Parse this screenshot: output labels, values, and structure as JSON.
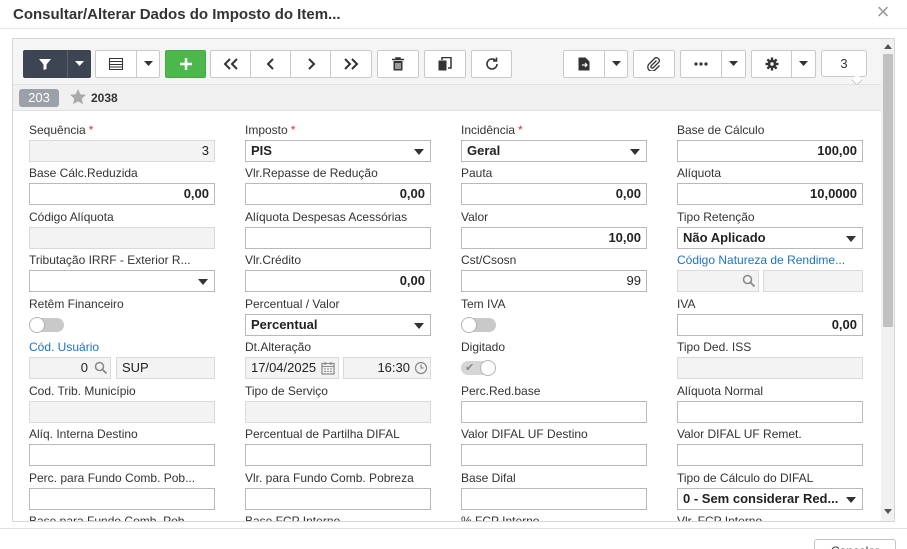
{
  "dialog": {
    "title": "Consultar/Alterar Dados do Imposto do Item...",
    "close_label": "×",
    "footer_button": "Cancelar"
  },
  "toolbar": {
    "icons": [
      "filter-icon",
      "chevron-down-icon",
      "grid-icon",
      "add-icon",
      "first-icon",
      "prev-icon",
      "next-icon",
      "last-icon",
      "trash-icon",
      "copy-icon",
      "refresh-icon",
      "export-icon",
      "attach-icon",
      "more-icon",
      "gear-icon"
    ],
    "counter": "3"
  },
  "record": {
    "id": "203",
    "code": "2038"
  },
  "fields": {
    "sequencia": {
      "label": "Sequência",
      "value": "3"
    },
    "imposto": {
      "label": "Imposto",
      "value": "PIS"
    },
    "incidencia": {
      "label": "Incidência",
      "value": "Geral"
    },
    "base_calculo": {
      "label": "Base de Cálculo",
      "value": "100,00"
    },
    "base_reduzida": {
      "label": "Base Cálc.Reduzida",
      "value": "0,00"
    },
    "vlr_repasse": {
      "label": "Vlr.Repasse de Redução",
      "value": "0,00"
    },
    "pauta": {
      "label": "Pauta",
      "value": "0,00"
    },
    "aliquota": {
      "label": "Alíquota",
      "value": "10,0000"
    },
    "codigo_aliquota": {
      "label": "Código Alíquota",
      "value": ""
    },
    "aliq_desp_acess": {
      "label": "Alíquota Despesas Acessórias",
      "value": ""
    },
    "valor": {
      "label": "Valor",
      "value": "10,00"
    },
    "tipo_retencao": {
      "label": "Tipo Retenção",
      "value": "Não Aplicado"
    },
    "tributacao_irrf": {
      "label": "Tributação IRRF - Exterior R...",
      "value": ""
    },
    "vlr_credito": {
      "label": "Vlr.Crédito",
      "value": "0,00"
    },
    "cst_csosn": {
      "label": "Cst/Csosn",
      "value": "99"
    },
    "codigo_natureza": {
      "label": "Código Natureza de Rendime...",
      "value": ""
    },
    "retem_financeiro": {
      "label": "Retêm Financeiro"
    },
    "percentual_valor": {
      "label": "Percentual / Valor",
      "value": "Percentual"
    },
    "tem_iva": {
      "label": "Tem IVA"
    },
    "iva": {
      "label": "IVA",
      "value": "0,00"
    },
    "cod_usuario": {
      "label": "Cód. Usuário",
      "value": "0",
      "name": "SUP"
    },
    "dt_alteracao": {
      "label": "Dt.Alteração",
      "date": "17/04/2025",
      "time": "16:30"
    },
    "digitado": {
      "label": "Digitado"
    },
    "tipo_ded_iss": {
      "label": "Tipo Ded. ISS",
      "value": ""
    },
    "cod_trib_municipio": {
      "label": "Cod. Trib. Município",
      "value": ""
    },
    "tipo_servico": {
      "label": "Tipo de Serviço",
      "value": ""
    },
    "perc_red_base": {
      "label": "Perc.Red.base",
      "value": ""
    },
    "aliquota_normal": {
      "label": "Alíquota Normal",
      "value": ""
    },
    "aliq_interna_destino": {
      "label": "Alíq. Interna Destino",
      "value": ""
    },
    "perc_partilha_difal": {
      "label": "Percentual de Partilha DIFAL",
      "value": ""
    },
    "valor_difal_uf_destino": {
      "label": "Valor DIFAL UF Destino",
      "value": ""
    },
    "valor_difal_uf_remet": {
      "label": "Valor DIFAL UF Remet.",
      "value": ""
    },
    "perc_fundo_comb_pob": {
      "label": "Perc. para Fundo Comb. Pob...",
      "value": ""
    },
    "vlr_fundo_comb_pobreza": {
      "label": "Vlr. para Fundo Comb. Pobreza",
      "value": ""
    },
    "base_difal": {
      "label": "Base Difal",
      "value": ""
    },
    "tipo_calculo_difal": {
      "label": "Tipo de Cálculo do DIFAL",
      "value": "0 - Sem considerar Red..."
    },
    "base_fundo_comb_pob": {
      "label": "Base para Fundo Comb. Pob..."
    },
    "base_fcp_interno": {
      "label": "Base FCP Interno"
    },
    "perc_fcp_interno": {
      "label": "% FCP Interno"
    },
    "vlr_fcp_interno": {
      "label": "Vlr. FCP Interno"
    }
  },
  "colors": {
    "accent_green": "#4cb84c",
    "dark_button": "#3d4552",
    "link_blue": "#1a73c9",
    "required_red": "#d9312b"
  }
}
